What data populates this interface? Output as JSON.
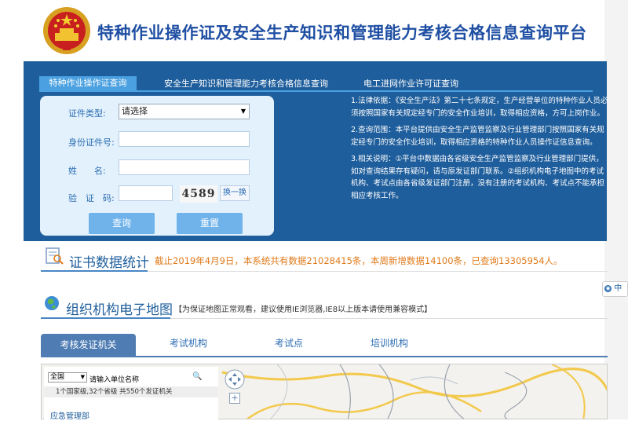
{
  "header": {
    "title": "特种作业操作证及安全生产知识和管理能力考核合格信息查询平台"
  },
  "query_tabs": [
    {
      "label": "特种作业操作证查询"
    },
    {
      "label": "安全生产知识和管理能力考核合格信息查询"
    },
    {
      "label": "电工进网作业许可证查询"
    }
  ],
  "form": {
    "cert_type_label": "证件类型:",
    "cert_type_value": "请选择",
    "id_label": "身份证件号:",
    "id_value": "",
    "name_label": "姓　　名:",
    "name_value": "",
    "captcha_label": "验　证　码:",
    "captcha_value": "",
    "captcha_text": "4589",
    "refresh_label": "换一换",
    "query_button": "查询",
    "reset_button": "重置"
  },
  "info": {
    "p1": "1.法律依据：《安全生产法》第二十七条规定，生产经营单位的特种作业人员必须按照国家有关规定经专门的安全作业培训，取得相应资格，方可上岗作业。",
    "p2": "2.查询范围：本平台提供由安全生产监管监察及行业管理部门按照国家有关规定经专门的安全作业培训，取得相应资格的特种作业人员操作证信息查询。",
    "p3": "3.相关说明：①平台中数据由各省级安全生产监管监察及行业管理部门提供，如对查询结果存有疑问，请与原发证部门联系。②组织机构电子地图中的考试机构、考试点由各省级发证部门注册，没有注册的考试机构、考试点不能承担相应考核工作。"
  },
  "stats": {
    "title": "证书数据统计",
    "text": "截止2019年4月9日，本系统共有数据21028415条，本周新增数据14100条，已查询13305954人。"
  },
  "map_section": {
    "title": "组织机构电子地图",
    "note": "【为保证地图正常观看，建议使用IE浏览器,IE8以上版本请使用兼容模式】",
    "tabs": [
      {
        "label": "考核发证机关"
      },
      {
        "label": "考试机构"
      },
      {
        "label": "考试点"
      },
      {
        "label": "培训机构"
      }
    ],
    "region_select": "全国",
    "unit_placeholder": "请输入单位名称",
    "summary": "1个国家级,32个省级 共550个发证机关",
    "first_item": "应急管理部"
  },
  "float_badge": {
    "label": "中"
  },
  "colors": {
    "panel_blue": "#1f5e9c",
    "active_tab": "#4aa0e0",
    "stats_orange": "#e07a1a",
    "button_blue": "#6fb3ea"
  }
}
